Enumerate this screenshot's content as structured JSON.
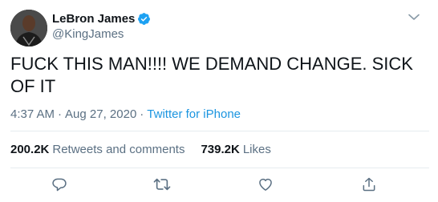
{
  "user": {
    "display_name": "LeBron James",
    "handle": "@KingJames",
    "verified": true
  },
  "tweet": {
    "text": "FUCK THIS MAN!!!! WE DEMAND CHANGE. SICK OF IT",
    "time": "4:37 AM",
    "separator_1": "·",
    "date": "Aug 27, 2020",
    "separator_2": "·",
    "source": "Twitter for iPhone"
  },
  "stats": {
    "retweets_value": "200.2K",
    "retweets_label": "Retweets and comments",
    "likes_value": "739.2K",
    "likes_label": "Likes"
  },
  "actions": {
    "reply_icon": "reply-icon",
    "retweet_icon": "retweet-icon",
    "like_icon": "heart-icon",
    "share_icon": "share-icon"
  },
  "colors": {
    "accent": "#1da1f2",
    "secondary_text": "#5b7083",
    "link": "#1b95e0",
    "divider": "#e6ecf0"
  }
}
